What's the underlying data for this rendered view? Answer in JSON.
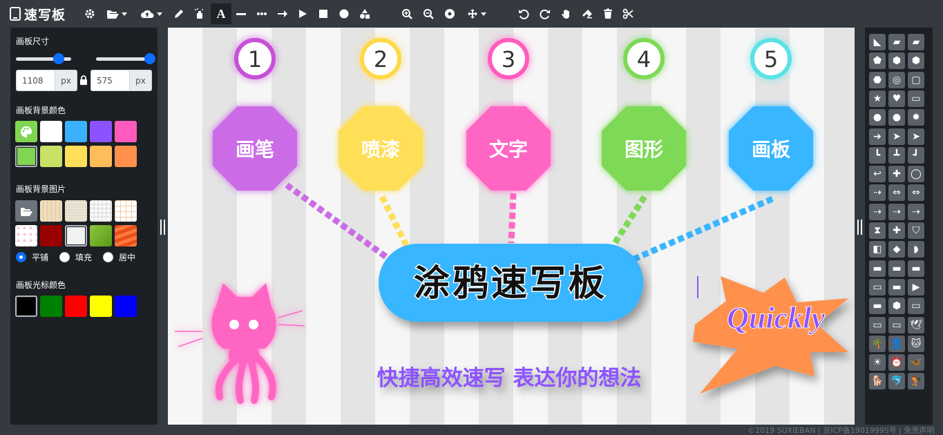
{
  "app": {
    "title": "速写板"
  },
  "toolbar": {
    "groups": [
      {
        "items": [
          "gear-icon",
          "folder-open-icon",
          "cloud-upload-icon",
          "pencil-icon",
          "spray-can-icon",
          "text-icon",
          "line-icon",
          "dotted-line-icon",
          "arrow-icon",
          "triangle-icon",
          "square-icon",
          "circle-icon",
          "shapes-icon"
        ]
      },
      {
        "items": [
          "zoom-in-icon",
          "zoom-out-icon",
          "zoom-reset-icon",
          "move-icon"
        ]
      },
      {
        "items": [
          "undo-icon",
          "redo-icon",
          "hand-icon",
          "eraser-icon",
          "trash-icon",
          "scissors-icon"
        ]
      }
    ]
  },
  "left_panel": {
    "size": {
      "label": "画板尺寸",
      "width": "1108",
      "height": "575",
      "unit": "px",
      "width_slider": 0.77,
      "height_slider": 0.97
    },
    "bg_color": {
      "label": "画板背景颜色",
      "colors": [
        "#ffffff",
        "#3ab0ff",
        "#8c52ff",
        "#ff5bbe",
        "#80d651",
        "#c9e265",
        "#ffde59",
        "#ffbd59",
        "#ff914d"
      ],
      "first_colors": [
        "#80d651"
      ],
      "selected": "#80d651"
    },
    "bg_image": {
      "label": "画板背景图片",
      "fill_modes": [
        "平铺",
        "填充",
        "居中"
      ],
      "selected_mode": "平铺"
    },
    "cursor_color": {
      "label": "画板光标颜色",
      "colors": [
        "#000000",
        "#008000",
        "#ff0000",
        "#ffff00",
        "#0000ff"
      ],
      "selected": "#000000"
    }
  },
  "canvas": {
    "steps": [
      {
        "num": "1",
        "label": "画笔",
        "color": "#cb6ce6",
        "ring": "#c850d8"
      },
      {
        "num": "2",
        "label": "喷漆",
        "color": "#ffde59",
        "ring": "#ffd84a"
      },
      {
        "num": "3",
        "label": "文字",
        "color": "#ff66c4",
        "ring": "#ff5cbf"
      },
      {
        "num": "4",
        "label": "图形",
        "color": "#7ed957",
        "ring": "#7ed957"
      },
      {
        "num": "5",
        "label": "画板",
        "color": "#38b6ff",
        "ring": "#5ce1e6"
      }
    ],
    "main_title": "涂鸦速写板",
    "tagline": "快捷高效速写 表达你的想法",
    "badge": "Quickly"
  },
  "footer": {
    "text": "©2019 SUXIEBAN | 京ICP备19019995号 | 免责声明"
  }
}
